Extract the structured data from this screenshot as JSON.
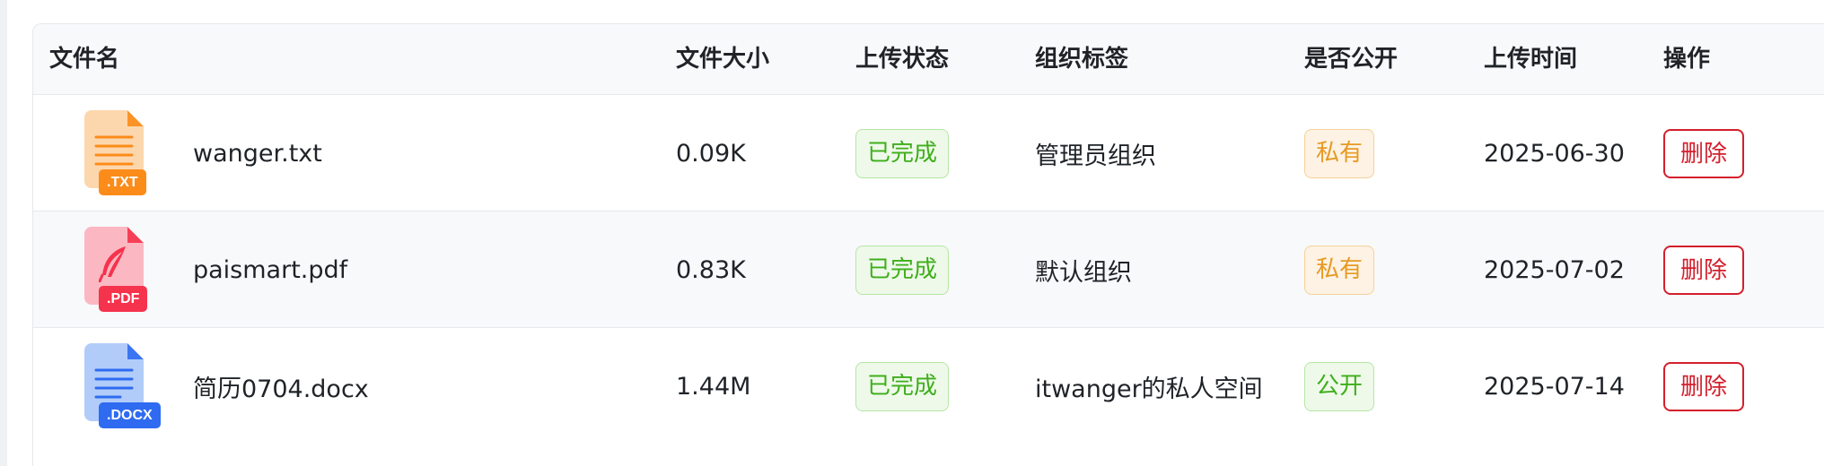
{
  "table": {
    "columns": {
      "name": "文件名",
      "size": "文件大小",
      "status": "上传状态",
      "org": "组织标签",
      "public": "是否公开",
      "time": "上传时间",
      "action": "操作"
    },
    "rows": [
      {
        "icon": "txt-file-icon",
        "ext": ".TXT",
        "name": "wanger.txt",
        "size": "0.09K",
        "status": "已完成",
        "org": "管理员组织",
        "visibility": "私有",
        "time": "2025-06-30",
        "action": "删除"
      },
      {
        "icon": "pdf-file-icon",
        "ext": ".PDF",
        "name": "paismart.pdf",
        "size": "0.83K",
        "status": "已完成",
        "org": "默认组织",
        "visibility": "私有",
        "time": "2025-07-02",
        "action": "删除"
      },
      {
        "icon": "docx-file-icon",
        "ext": ".DOCX",
        "name": "简历0704.docx",
        "size": "1.44M",
        "status": "已完成",
        "org": "itwanger的私人空间",
        "visibility": "公开",
        "time": "2025-07-14",
        "action": "删除"
      }
    ]
  },
  "colors": {
    "txt": "#fb8c1a",
    "txt_page": "#fcd7ad",
    "pdf": "#f5334d",
    "pdf_page": "#fbb8c2",
    "docx": "#2f6bf0",
    "docx_page": "#b2ccfa",
    "danger": "#d41f2c",
    "success": "#3fae1b",
    "warning": "#e69a24"
  }
}
